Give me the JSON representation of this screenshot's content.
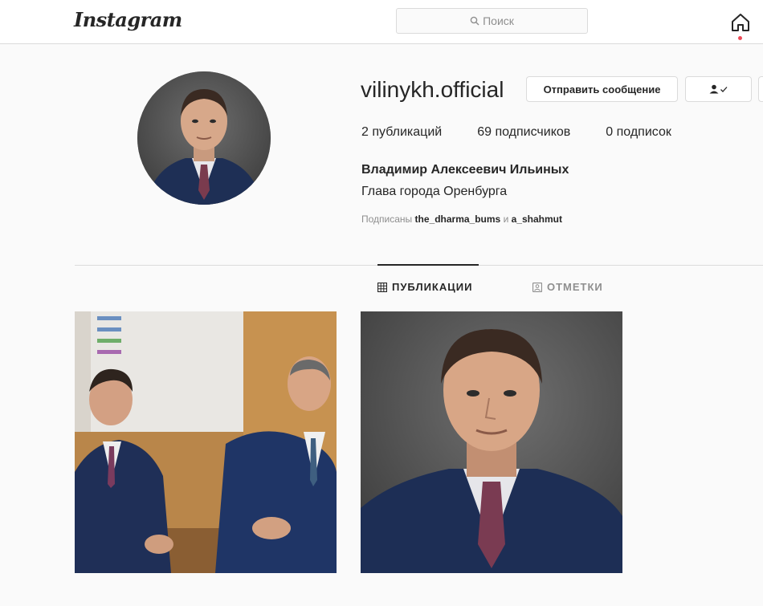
{
  "nav": {
    "logo": "Instagram",
    "search_placeholder": "Поиск",
    "icons": [
      "search-icon",
      "home-icon"
    ]
  },
  "profile": {
    "username": "vilinykh.official",
    "buttons": {
      "message": "Отправить сообщение"
    },
    "stats": {
      "posts": "2 публикаций",
      "followers": "69 подписчиков",
      "following": "0 подписок"
    },
    "full_name": "Владимир Алексеевич Ильиных",
    "bio": "Глава города Оренбурга",
    "followed_by": {
      "prefix": "Подписаны",
      "user1": "the_dharma_bums",
      "joiner": "и",
      "user2": "a_shahmut"
    }
  },
  "tabs": [
    {
      "label": "ПУБЛИКАЦИИ",
      "active": true,
      "icon": "grid-icon"
    },
    {
      "label": "ОТМЕТКИ",
      "active": false,
      "icon": "tagged-icon"
    }
  ],
  "colors": {
    "text": "#262626",
    "muted": "#8e8e8e",
    "border": "#dbdbdb",
    "notification": "#ed4956",
    "background": "#fafafa"
  }
}
